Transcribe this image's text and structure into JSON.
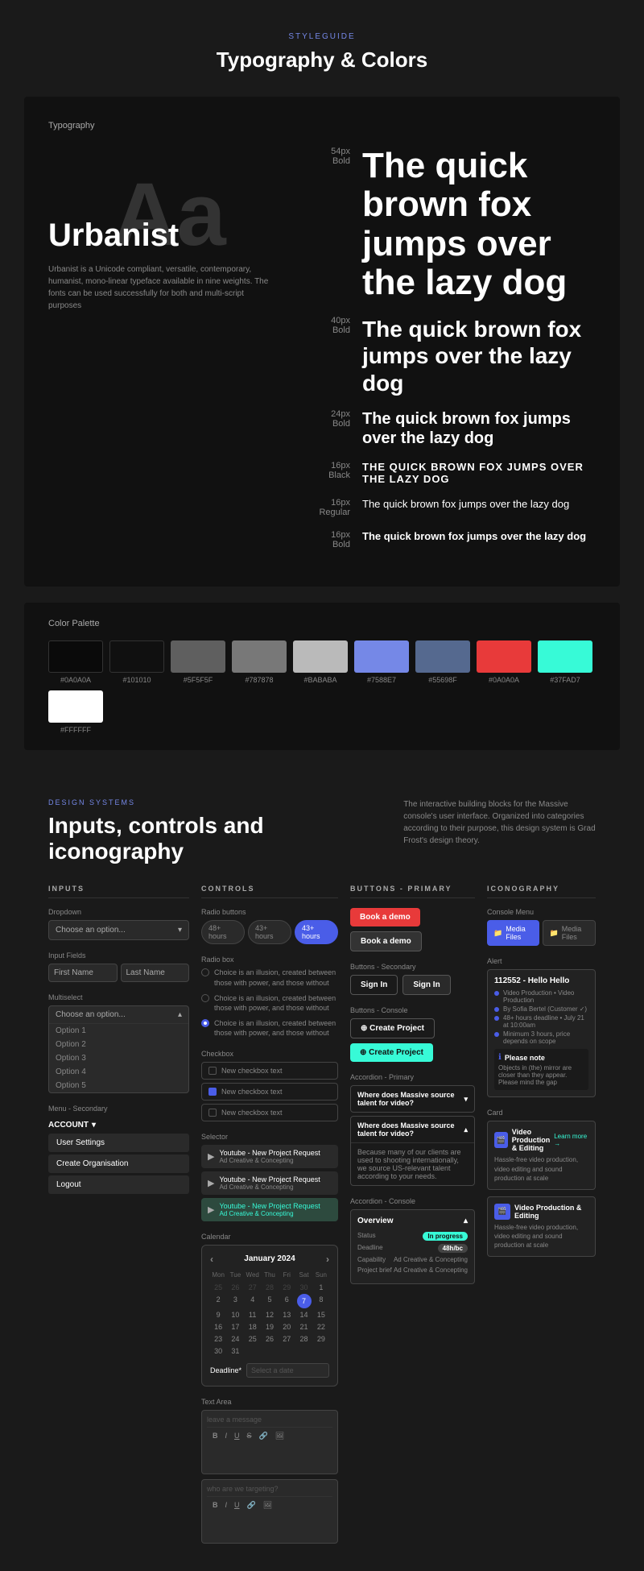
{
  "page": {
    "styleguide_label": "STYLEGUIDE",
    "title": "Typography & Colors"
  },
  "typography": {
    "section_label": "Typography",
    "specimen_word": "Urbanist",
    "specimen_letter": "Aa",
    "description": "Urbanist is a Unicode compliant, versatile, contemporary, humanist, mono-linear typeface available in nine weights. The fonts can be used successfully for both and multi-script purposes",
    "rows": [
      {
        "size": "54px",
        "weight": "Bold",
        "sample": "The quick brown fox jumps over the lazy dog",
        "class": "sample-54"
      },
      {
        "size": "40px",
        "weight": "Bold",
        "sample": "The quick brown fox jumps over the lazy dog",
        "class": "sample-40"
      },
      {
        "size": "24px",
        "weight": "Bold",
        "sample": "The quick brown fox jumps over the lazy dog",
        "class": "sample-24"
      },
      {
        "size": "16px",
        "weight": "Black",
        "sample": "THE QUICK BROWN FOX JUMPS OVER THE LAZY DOG",
        "class": "sample-16black"
      },
      {
        "size": "16px",
        "weight": "Regular",
        "sample": "The quick brown fox jumps over the lazy dog",
        "class": "sample-16reg"
      },
      {
        "size": "16px",
        "weight": "Bold",
        "sample": "The quick brown fox jumps over the lazy dog",
        "class": "sample-16bold"
      }
    ]
  },
  "colors": {
    "section_label": "Color Palette",
    "swatches": [
      {
        "hex": "#0A0A0A",
        "label": "#0A0A0A"
      },
      {
        "hex": "#101010",
        "label": "#101010"
      },
      {
        "hex": "#5F5F5F",
        "label": "#5F5F5F"
      },
      {
        "hex": "#787878",
        "label": "#787878"
      },
      {
        "hex": "#BABABA",
        "label": "#BABABA"
      },
      {
        "hex": "#7588E7",
        "label": "#7588E7"
      },
      {
        "hex": "#55698F",
        "label": "#55698F"
      },
      {
        "hex": "#0A0A0A",
        "label": "#0A0A0A"
      },
      {
        "hex": "#37FAD7",
        "label": "#37FAD7"
      },
      {
        "hex": "#FFFFFF",
        "label": "#FFFFFF"
      }
    ]
  },
  "design_systems": {
    "label": "DESIGN SYSTEMS",
    "title": "Inputs, controls and iconography",
    "description": "The interactive building blocks for the Massive console's user interface. Organized into categories according to their purpose, this design system is Grad Frost's design theory."
  },
  "inputs": {
    "header": "INPUTS",
    "dropdown": {
      "label": "Dropdown",
      "placeholder": "Choose an option..."
    },
    "input_fields": {
      "label": "Input Fields",
      "first": "First Name",
      "last": "Last Name"
    },
    "multiselect": {
      "label": "Multiselect",
      "placeholder": "Choose an option...",
      "options": [
        "Option 1",
        "Option 2",
        "Option 3",
        "Option 4",
        "Option 5"
      ]
    },
    "textarea": {
      "label": "Text Area",
      "placeholder": "leave a message",
      "placeholder2": "who are we targeting?"
    },
    "menu": {
      "label": "Menu - Secondary",
      "account": "ACCOUNT",
      "items": [
        "User Settings",
        "Create Organisation",
        "Logout"
      ]
    }
  },
  "controls": {
    "header": "CONTROLS",
    "radio_buttons": {
      "label": "Radio buttons",
      "pills": [
        "48+ hours",
        "43+ hours",
        "43+ hours"
      ],
      "active": 2
    },
    "radio_box": {
      "label": "Radio box",
      "options": [
        "Choice is an illusion, created between those with power, and those without",
        "Choice is an illusion, created between those with power, and those without",
        "Choice is an illusion, created between those with power, and those without"
      ],
      "checked": 2
    },
    "checkbox": {
      "label": "Checkbox",
      "options": [
        "New checkbox text",
        "New checkbox text",
        "New checkbox text"
      ],
      "checked": [
        2
      ]
    },
    "selector": {
      "label": "Selector",
      "options": [
        "Youtube - New Project Request\nAd Creative & Concepting",
        "Youtube - New Project Request\nAd Creative & Concepting",
        "Youtube - New Project Request\nAd Creative & Concepting"
      ]
    },
    "calendar": {
      "label": "Calendar",
      "month": "January 2024",
      "days_header": [
        "Mon",
        "Tue",
        "Wed",
        "Thu",
        "Fri",
        "Sat",
        "Sun"
      ],
      "today": 7,
      "deadline_label": "Deadline*",
      "deadline_placeholder": "Select a date"
    }
  },
  "buttons": {
    "header": "Buttons - Primary",
    "primary": [
      "Book a demo",
      "Book a demo"
    ],
    "secondary_header": "Buttons - Secondary",
    "secondary": [
      "Sign In",
      "Sign In"
    ],
    "console_header": "Buttons - Console",
    "console": [
      "Create Project",
      "Create Project"
    ],
    "accordion_primary_header": "Accordion - Primary",
    "accordion_primary": [
      {
        "q": "Where does Massive source talent for video?",
        "open": false
      },
      {
        "q": "Where does Massive source talent for video?",
        "body": "Because many of our clients are used to shooting internationally, we source US-relevant talent according to your needs.",
        "open": true
      }
    ],
    "accordion_console_header": "Accordion - Console",
    "accordion_console": {
      "title": "Overview",
      "rows": [
        {
          "key": "Status",
          "val": "In progress",
          "type": "badge"
        },
        {
          "key": "Deadline",
          "val": "48h/bc",
          "type": "badge-gray"
        },
        {
          "key": "Capability",
          "val": "Ad Creative & Concepting",
          "type": "text"
        },
        {
          "key": "Project brief",
          "val": "Ad Creative & Concepting",
          "type": "text"
        }
      ]
    }
  },
  "iconography": {
    "header": "ICONOGRAPHY",
    "console_menu": {
      "label": "Console Menu",
      "items": [
        "Media Files",
        "Media Files"
      ]
    },
    "alert": {
      "label": "Alert",
      "title": "112552 - Hello Hello",
      "rows": [
        "Video Production • Video Production",
        "By Sofia Bertel (Customer ✓)",
        "48+ hours deadline • July 21 at 10:00am",
        "Minimum 3 hours, price depends on scope"
      ],
      "note_title": "Please note",
      "note_body": "Objects in (the) mirror are closer than they appear. Please mind the gap"
    },
    "cards": [
      {
        "label": "Card",
        "title": "Video Production & Editing",
        "link": "Learn more →",
        "desc": "Hassle-free video production, video editing and sound production at scale"
      },
      {
        "title": "Video Production & Editing",
        "link": "",
        "desc": "Hassle-free video production, video editing and sound production at scale"
      }
    ]
  }
}
